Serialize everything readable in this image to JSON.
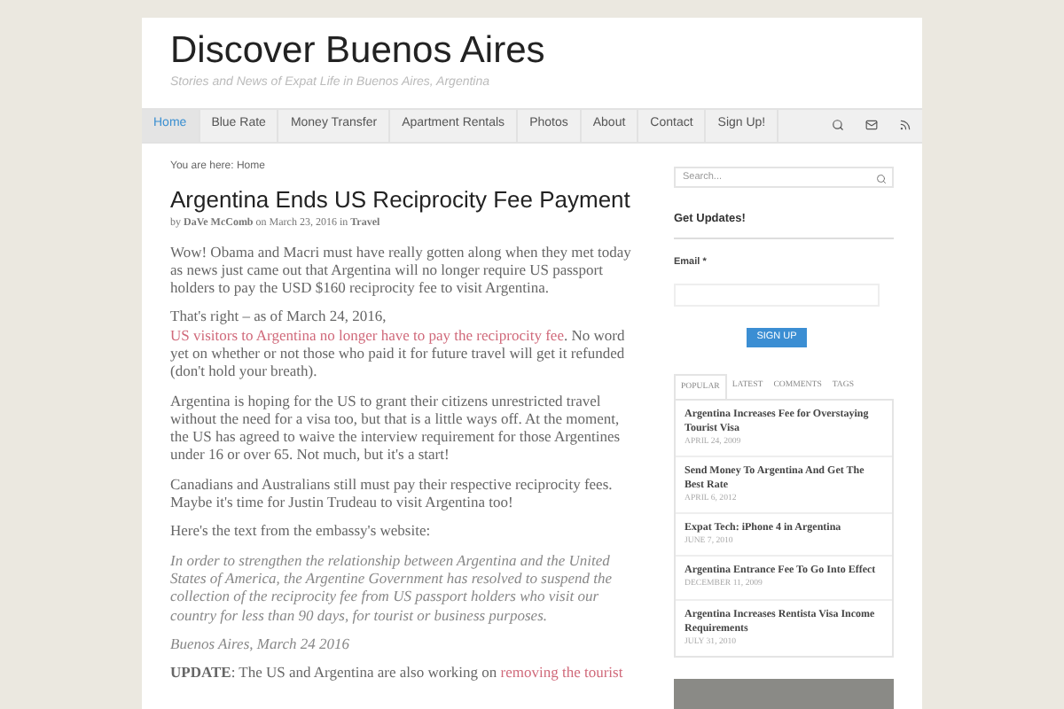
{
  "site": {
    "title": "Discover Buenos Aires",
    "tagline": "Stories and News of Expat Life in Buenos Aires, Argentina"
  },
  "nav": [
    {
      "label": "Home",
      "selected": true
    },
    {
      "label": "Blue Rate",
      "selected": false
    },
    {
      "label": "Money Transfer",
      "selected": false
    },
    {
      "label": "Apartment Rentals",
      "selected": false
    },
    {
      "label": "Photos",
      "selected": false
    },
    {
      "label": "About",
      "selected": false
    },
    {
      "label": "Contact",
      "selected": false
    },
    {
      "label": "Sign Up!",
      "selected": false
    }
  ],
  "breadcrumb": "You are here: Home",
  "post": {
    "title": "Argentina Ends US Reciprocity Fee Payment",
    "meta": "by **DaVe McComb** on March 23, 2016 in **Travel**",
    "paragraphs": [
      {
        "kind": "text",
        "parts": [
          {
            "text": "Wow! Obama and Macri must have really gotten along when they met today as news just came out that Argentina will no longer require US passport holders to pay the USD $160 reciprocity fee to visit Argentina.",
            "link": false
          }
        ]
      },
      {
        "kind": "text",
        "parts": [
          {
            "text": "That's right – as of March 24, 2016, ",
            "link": false
          },
          {
            "text": "US visitors to Argentina no longer have to pay the reciprocity fee",
            "link": true
          },
          {
            "text": ". No word yet on whether or not those who paid it for future travel will get it refunded (don't hold your breath).",
            "link": false
          }
        ]
      },
      {
        "kind": "text",
        "parts": [
          {
            "text": "Argentina is hoping for the US to grant their citizens unrestricted travel without the need for a visa too, but that is a little ways off. At the moment, the US has agreed to waive the interview requirement for those Argentines under 16 or over 65. Not much, but it's a start!",
            "link": false
          }
        ]
      },
      {
        "kind": "text",
        "parts": [
          {
            "text": "Canadians and Australians still must pay their respective reciprocity fees. Maybe it's time for Justin Trudeau to visit Argentina too!",
            "link": false
          }
        ]
      },
      {
        "kind": "text",
        "parts": [
          {
            "text": "Here's the text from the embassy's website:",
            "link": false
          }
        ]
      },
      {
        "kind": "quote",
        "parts": [
          {
            "text": "In order to strengthen the relationship between Argentina and the United States of America, the Argentine Government has resolved to suspend the collection of the reciprocity fee from US passport holders who visit our country for less than 90 days, for tourist or business purposes.",
            "link": false
          }
        ]
      },
      {
        "kind": "quote",
        "parts": [
          {
            "text": "Buenos Aires, March 24 2016",
            "link": false
          }
        ]
      },
      {
        "kind": "text",
        "parts": [
          {
            "text": "**UPDATE**: The US and Argentina are also working on ",
            "link": false
          },
          {
            "text": "removing the tourist",
            "link": true
          }
        ]
      }
    ]
  },
  "sidebar": {
    "search": {
      "placeholder": "Search..."
    },
    "widget_title": "Get Updates!",
    "email_label": "Email *",
    "button": "SIGN UP",
    "tabs": [
      {
        "label": "POPULAR",
        "selected": true
      },
      {
        "label": "LATEST",
        "selected": false
      },
      {
        "label": "COMMENTS",
        "selected": false
      },
      {
        "label": "TAGS",
        "selected": false
      }
    ],
    "posts": [
      {
        "title": "Argentina Increases Fee for Overstaying Tourist Visa",
        "date": "APRIL 24, 2009"
      },
      {
        "title": "Send Money To Argentina And Get The Best Rate",
        "date": "APRIL 6, 2012"
      },
      {
        "title": "Expat Tech: iPhone 4 in Argentina",
        "date": "JUNE 7, 2010"
      },
      {
        "title": "Argentina Entrance Fee To Go Into Effect",
        "date": "DECEMBER 11, 2009"
      },
      {
        "title": "Argentina Increases Rentista Visa Income Requirements",
        "date": "JULY 31, 2010"
      }
    ]
  }
}
